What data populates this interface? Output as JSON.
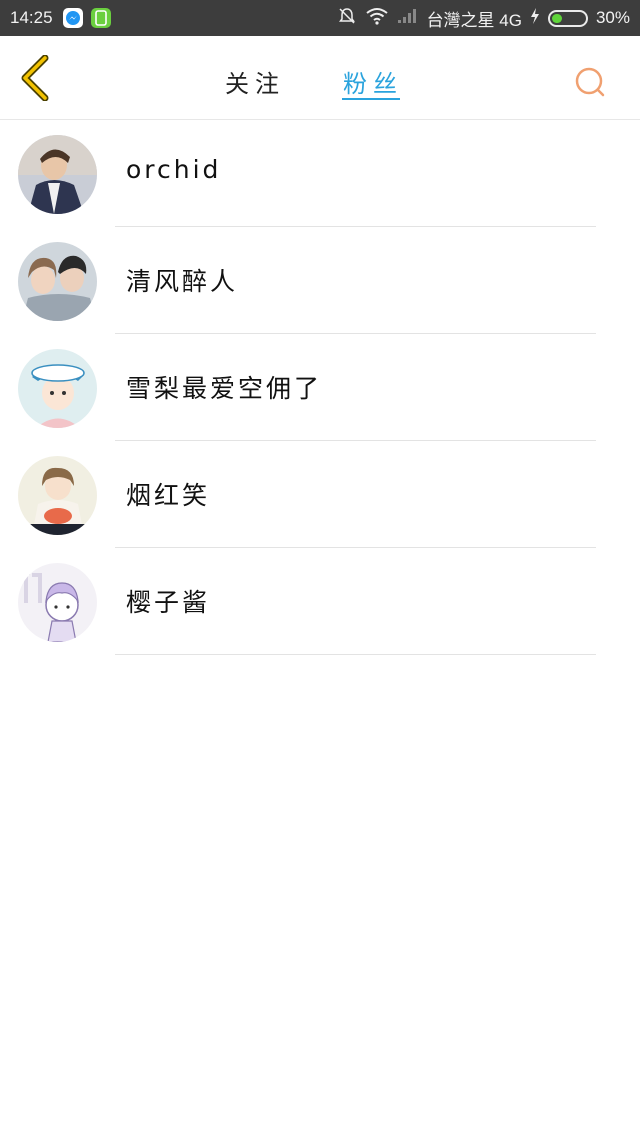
{
  "status_bar": {
    "time": "14:25",
    "carrier": "台灣之星 4G",
    "battery_percent": "30%",
    "battery_level": 0.3,
    "icons": [
      "messenger-icon",
      "phone-app-icon",
      "mute-icon",
      "wifi-icon",
      "signal-icon",
      "charging-icon",
      "battery-icon"
    ]
  },
  "header": {
    "back_icon": "chevron-left-icon",
    "tabs": [
      {
        "label": "关注",
        "active": false
      },
      {
        "label": "粉丝",
        "active": true
      }
    ],
    "search_icon": "search-icon",
    "accent_color": "#2aa3dd",
    "back_color": "#f2c200",
    "search_color": "#f0a070"
  },
  "fans": [
    {
      "name": "orchid",
      "avatar": "avatar-photo"
    },
    {
      "name": "清风醉人",
      "avatar": "avatar-photo"
    },
    {
      "name": "雪梨最爱空佣了",
      "avatar": "avatar-illustration"
    },
    {
      "name": "烟红笑",
      "avatar": "avatar-illustration"
    },
    {
      "name": "樱子酱",
      "avatar": "avatar-illustration"
    }
  ]
}
